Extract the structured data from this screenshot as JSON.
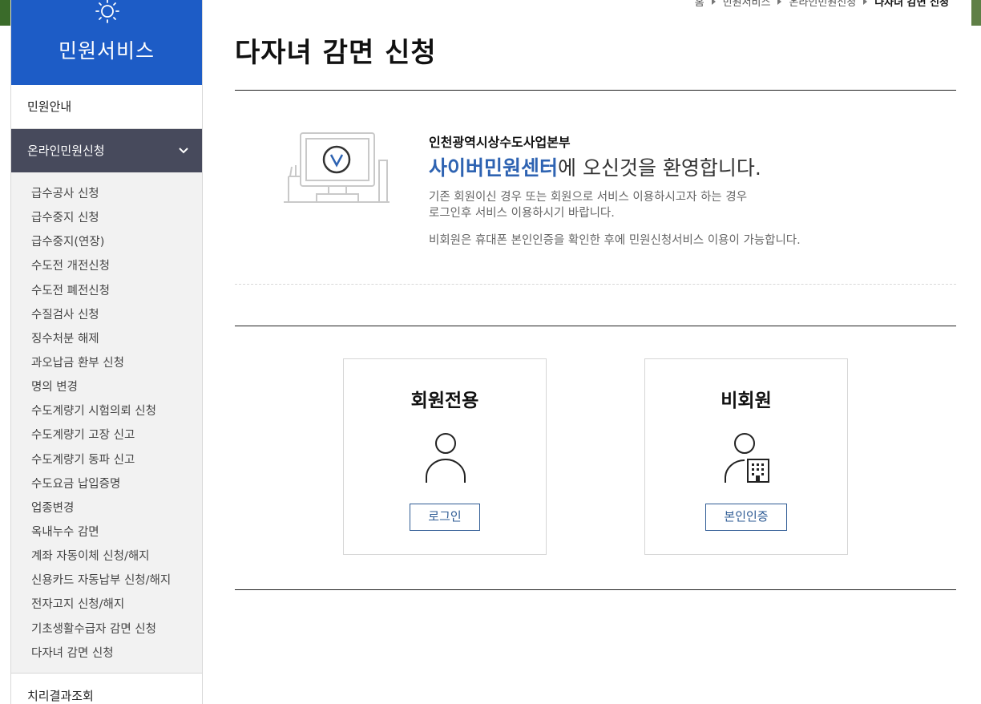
{
  "sidebar": {
    "title": "민원서비스",
    "items": [
      {
        "label": "민원안내"
      },
      {
        "label": "온라인민원신청"
      },
      {
        "label": "치리결과조회"
      }
    ],
    "submenu": [
      "급수공사 신청",
      "급수중지 신청",
      "급수중지(연장)",
      "수도전 개전신청",
      "수도전 폐전신청",
      "수질검사 신청",
      "징수처분 해제",
      "과오납금 환부 신청",
      "명의 변경",
      "수도계량기 시험의뢰 신청",
      "수도계량기 고장 신고",
      "수도계량기 동파 신고",
      "수도요금 납입증명",
      "업종변경",
      "옥내누수 감면",
      "계좌 자동이체 신청/해지",
      "신용카드 자동납부 신청/해지",
      "전자고지 신청/해지",
      "기초생활수급자 감면 신청",
      "다자녀 감면 신청"
    ]
  },
  "breadcrumb": {
    "home": "홈",
    "level1": "민원서비스",
    "level2": "온라인민원신청",
    "current": "다자녀 감면 신청"
  },
  "page": {
    "title": "다자녀 감면 신청"
  },
  "welcome": {
    "org": "인천광역시상수도사업본부",
    "highlight": "사이버민원센터",
    "rest": "에 오신것을 환영합니다.",
    "desc_line1": "기존 회원이신 경우 또는 회원으로 서비스 이용하시고자 하는 경우",
    "desc_line2": "로그인후 서비스 이용하시기 바랍니다.",
    "desc_line3": "비회원은 휴대폰 본인인증을 확인한 후에 민원신청서비스 이용이 가능합니다."
  },
  "cards": {
    "member": {
      "title": "회원전용",
      "button": "로그인",
      "icon": "person-icon"
    },
    "guest": {
      "title": "비회원",
      "button": "본인인증",
      "icon": "person-building-icon"
    }
  },
  "colors": {
    "sidebar_header": "#1d5cc6",
    "sidebar_active": "#474a5c",
    "accent_blue": "#2e63b2",
    "button_border": "#2e5b94"
  }
}
